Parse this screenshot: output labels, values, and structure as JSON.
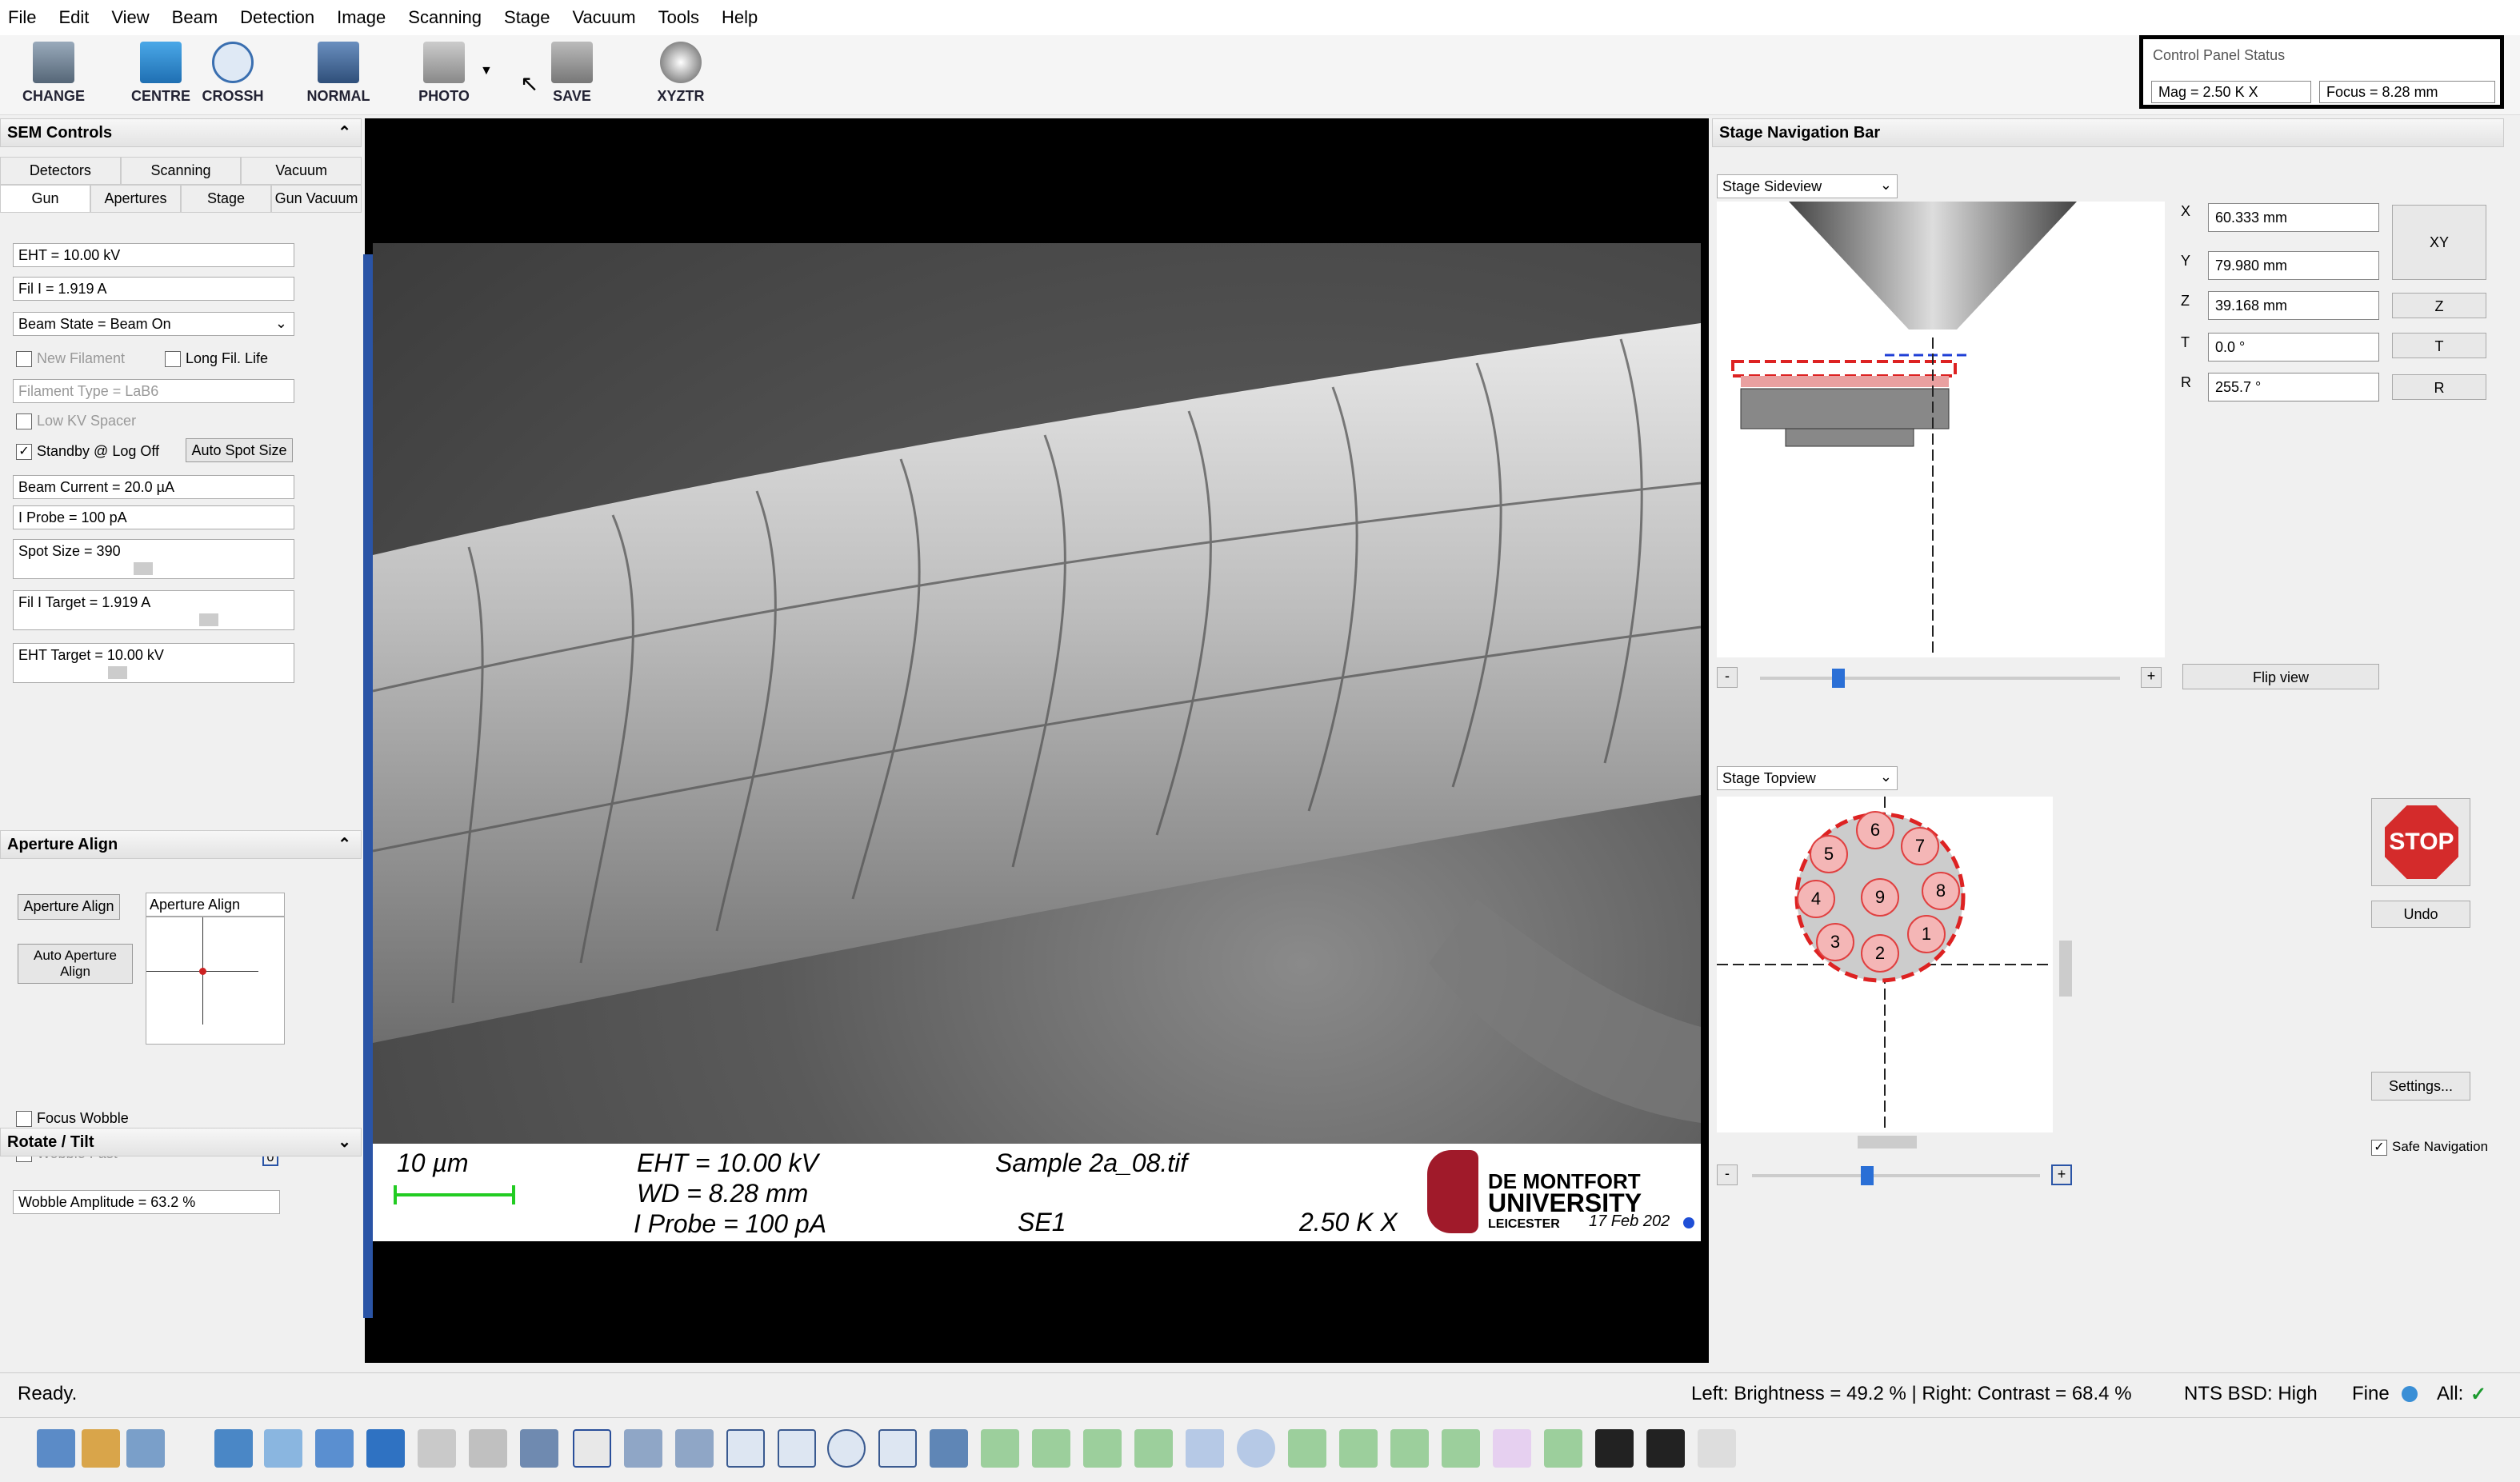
{
  "menu": [
    "File",
    "Edit",
    "View",
    "Beam",
    "Detection",
    "Image",
    "Scanning",
    "Stage",
    "Vacuum",
    "Tools",
    "Help"
  ],
  "toolbar": {
    "change": "CHANGE",
    "centre": "CENTRE",
    "crossh": "CROSSH",
    "normal": "NORMAL",
    "photo": "PHOTO",
    "save": "SAVE",
    "xyztr": "XYZTR"
  },
  "control_panel_status": {
    "title": "Control Panel Status",
    "mag": "Mag =   2.50 K X",
    "focus": "Focus = 8.28 mm"
  },
  "sem_controls": {
    "title": "SEM Controls",
    "tabs_row1": [
      "Detectors",
      "Scanning",
      "Vacuum"
    ],
    "tabs_row2": [
      "Gun",
      "Apertures",
      "Stage",
      "Gun Vacuum"
    ],
    "eht": "EHT = 10.00 kV",
    "fil_i": "Fil I =  1.919 A",
    "beam_state": "Beam State = Beam On",
    "new_filament": "New Filament",
    "long_fil_life": "Long Fil. Life",
    "filament_type": "Filament Type = LaB6",
    "low_kv_spacer": "Low KV Spacer",
    "standby": "Standby @ Log Off",
    "auto_spot_size": "Auto Spot Size",
    "beam_current": "Beam Current =   20.0 µA",
    "i_probe": "I Probe =    100 pA",
    "spot_size": "Spot Size = 390",
    "fil_i_target": "Fil I Target =  1.919 A",
    "eht_target": "EHT Target = 10.00 kV"
  },
  "aperture_align": {
    "title": "Aperture Align",
    "button": "Aperture Align",
    "box_title": "Aperture Align",
    "auto_button": "Auto Aperture Align",
    "focus_wobble": "Focus Wobble",
    "wobble_fast": "Wobble Fast",
    "wobble_amplitude": "Wobble Amplitude =  63.2 %",
    "zero": "0"
  },
  "rotate_tilt": {
    "title": "Rotate / Tilt"
  },
  "databar": {
    "scale": "10 µm",
    "eht": "EHT = 10.00 kV",
    "wd": "WD = 8.28 mm",
    "i_probe": "I Probe =    100 pA",
    "sample": "Sample 2a_08.tif",
    "detector": "SE1",
    "mag": "2.50 K X",
    "logo_line1": "DE MONTFORT",
    "logo_line2": "UNIVERSITY",
    "logo_line3": "LEICESTER",
    "date": "17 Feb 202"
  },
  "stage_nav": {
    "title": "Stage Navigation Bar",
    "sideview": "Stage Sideview",
    "topview": "Stage Topview",
    "x_label": "X",
    "x": "60.333 mm",
    "y_label": "Y",
    "y": "79.980 mm",
    "z_label": "Z",
    "z": "39.168 mm",
    "t_label": "T",
    "t": "0.0 °",
    "r_label": "R",
    "r": "255.7 °",
    "btn_xy": "XY",
    "btn_z": "Z",
    "btn_t": "T",
    "btn_r": "R",
    "flip_view": "Flip view",
    "stop": "STOP",
    "undo": "Undo",
    "settings": "Settings...",
    "safe_navigation": "Safe Navigation",
    "minus": "-",
    "plus": "+",
    "holders": [
      "6",
      "7",
      "5",
      "8",
      "4",
      "9",
      "3",
      "1",
      "2"
    ]
  },
  "status": {
    "ready": "Ready.",
    "brightness": "Left: Brightness = 49.2 % | Right: Contrast = 68.4 %",
    "detector": "NTS BSD: High",
    "fine": "Fine",
    "all": "All:"
  },
  "colors": {
    "accent_blue": "#2a54a6",
    "stop_red": "#d42b2b",
    "holder_red": "#e04040",
    "holder_fill": "#f4b6b6",
    "ok_green": "#1b9a2e"
  }
}
